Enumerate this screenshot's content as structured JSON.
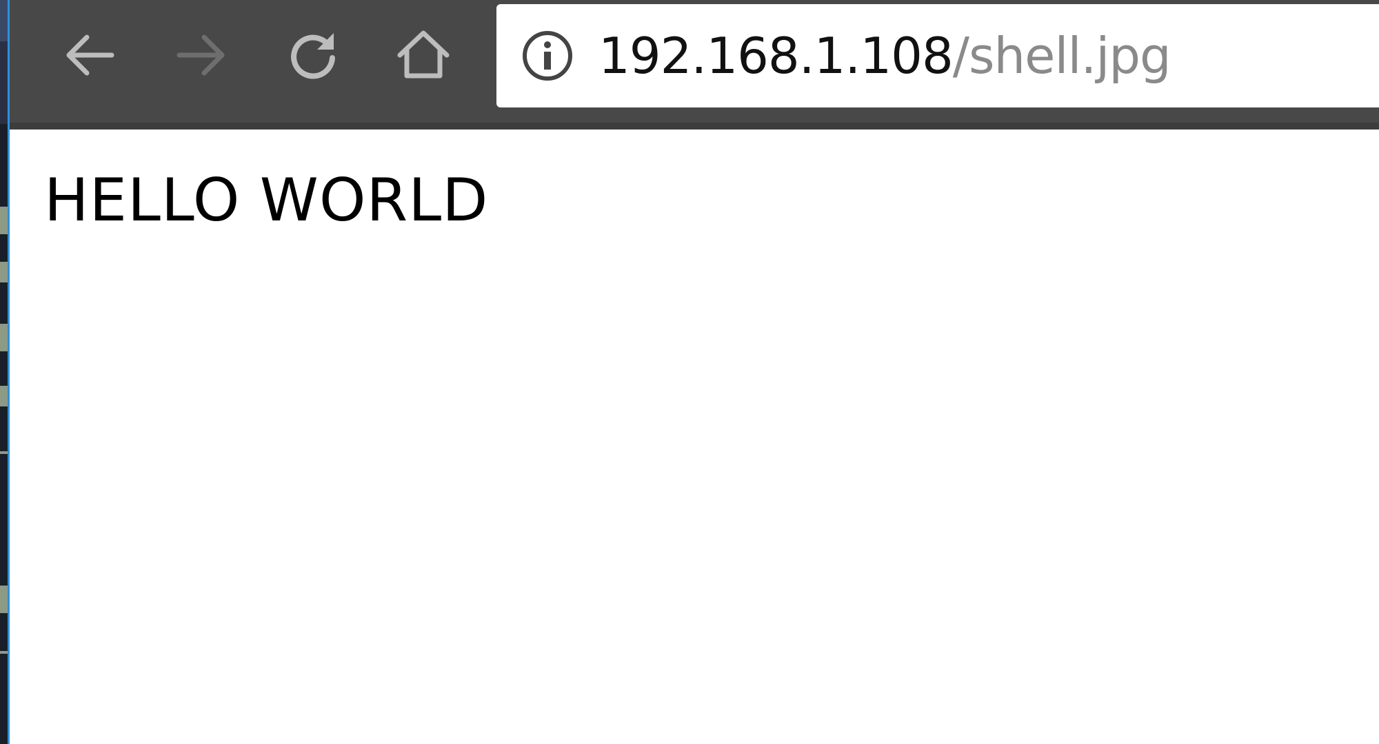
{
  "browser": {
    "toolbar": {
      "back_icon": "arrow-left-icon",
      "forward_icon": "arrow-right-icon",
      "reload_icon": "reload-icon",
      "home_icon": "home-icon"
    },
    "address_bar": {
      "info_icon": "info-icon",
      "url_host": "192.168.1.108",
      "url_path": "/shell.jpg"
    }
  },
  "page": {
    "text": "HELLO WORLD"
  },
  "colors": {
    "toolbar": "#484848",
    "icon_enabled": "#bdbdbd",
    "icon_disabled": "#6e6e6e",
    "url_host": "#111111",
    "url_path": "#8a8a8a",
    "window_frame": "#2f8fd8"
  }
}
